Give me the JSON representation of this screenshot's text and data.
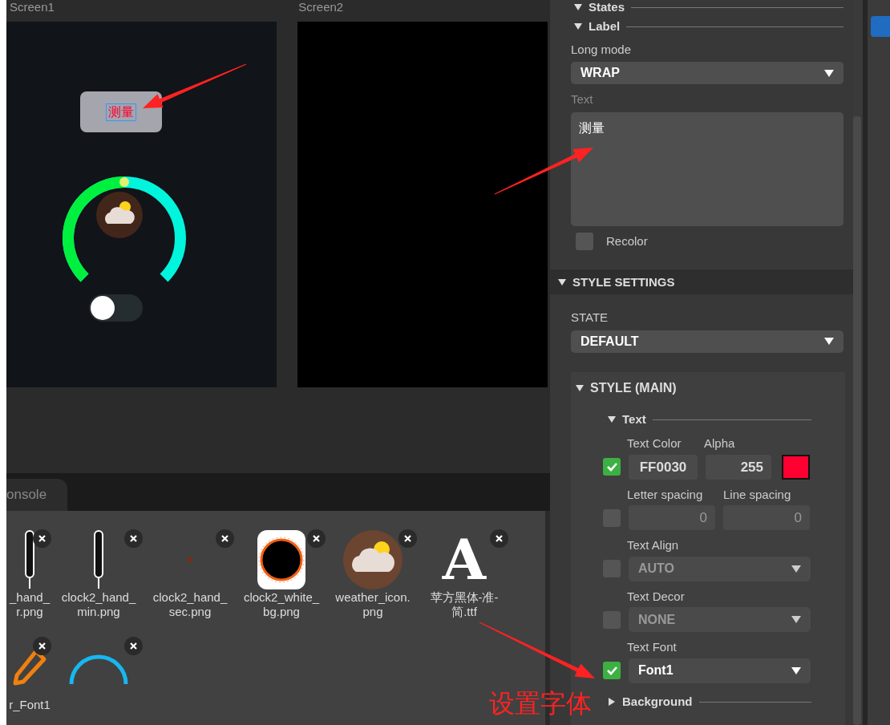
{
  "screens": [
    {
      "title": "Screen1",
      "kind": "widgets"
    },
    {
      "title": "Screen2",
      "kind": "empty"
    }
  ],
  "widgets": {
    "button": {
      "label": "测量",
      "selected": true
    },
    "arc": {
      "level": 0.5
    },
    "switch": {
      "checked": false
    }
  },
  "bottom_panel": {
    "tabs": [
      {
        "label": "onsole",
        "selected": true
      }
    ],
    "assets": [
      {
        "kind": "hand",
        "name": "_hand_\nr.png"
      },
      {
        "kind": "hand",
        "name": "clock2_hand_\nmin.png"
      },
      {
        "kind": "dot",
        "name": "clock2_hand_\nsec.png"
      },
      {
        "kind": "clock",
        "name": "clock2_white_\nbg.png"
      },
      {
        "kind": "weather",
        "name": "weather_icon.\npng"
      },
      {
        "kind": "font",
        "glyph": "A",
        "name": "苹方黑体-准-\n简.ttf"
      },
      {
        "kind": "pencil",
        "name": "r_Font1"
      },
      {
        "kind": "arc"
      }
    ]
  },
  "inspector": {
    "states": {
      "title": "States",
      "expanded": true
    },
    "label_section": {
      "title": "Label",
      "expanded": true
    },
    "long_mode": {
      "label": "Long mode",
      "value": "WRAP"
    },
    "text": {
      "label": "Text",
      "value": "测量"
    },
    "recolor": {
      "label": "Recolor",
      "checked": false
    },
    "style_settings": {
      "title": "STYLE SETTINGS",
      "expanded": true
    },
    "state": {
      "label": "STATE",
      "value": "DEFAULT"
    },
    "style_main": {
      "title": "STYLE (MAIN)",
      "expanded": true,
      "text_section": {
        "title": "Text",
        "expanded": true
      },
      "rows": [
        {
          "kind": "color",
          "labels": [
            "Text Color",
            "Alpha"
          ],
          "checked": true,
          "hex": "FF0030",
          "alpha": "255"
        },
        {
          "kind": "pair",
          "labels": [
            "Letter spacing",
            "Line spacing"
          ],
          "checked": false,
          "values": [
            "0",
            "0"
          ]
        },
        {
          "kind": "select",
          "label": "Text Align",
          "checked": false,
          "value": "AUTO"
        },
        {
          "kind": "select",
          "label": "Text Decor",
          "checked": false,
          "value": "NONE"
        },
        {
          "kind": "select",
          "label": "Text Font",
          "checked": true,
          "value": "Font1"
        }
      ],
      "background_section": {
        "title": "Background",
        "expanded": false
      }
    }
  },
  "annotation": {
    "note": "设置字体"
  }
}
